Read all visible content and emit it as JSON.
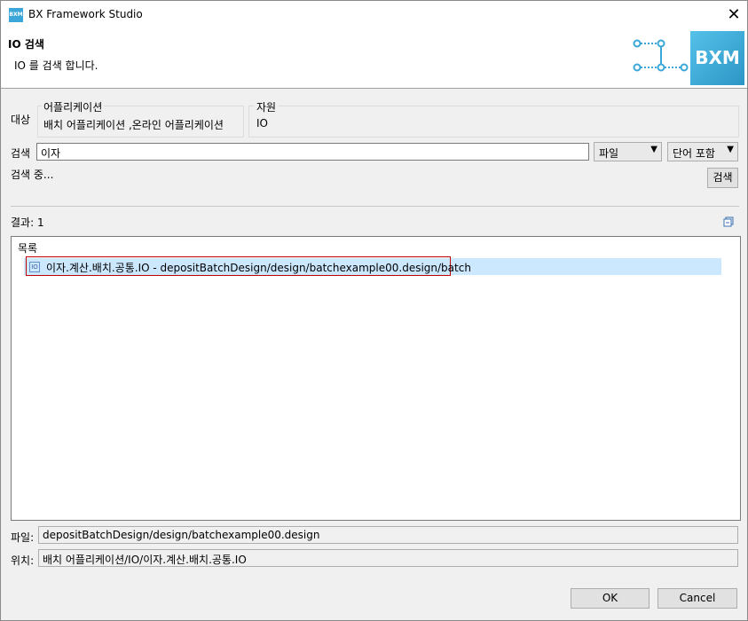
{
  "window": {
    "title": "BX Framework Studio",
    "app_icon_label": "BXM",
    "close_glyph": "✕"
  },
  "header": {
    "title": "IO 검색",
    "description": "IO 를 검색 합니다.",
    "logo_text": "BXM"
  },
  "target": {
    "label": "대상",
    "application_group": {
      "title": "어플리케이션",
      "value": "배치 어플리케이션 ,온라인 어플리케이션"
    },
    "resource_group": {
      "title": "자원",
      "value": "IO"
    }
  },
  "search": {
    "label": "검색",
    "query": "이자",
    "scope_select": "파일",
    "match_select": "단어 포함",
    "status": "검색 중...",
    "button": "검색"
  },
  "results": {
    "label": "결과: 1",
    "list_header": "목록",
    "items": [
      {
        "icon": "IO",
        "text": "이자.계산.배치.공통.IO - depositBatchDesign/design/batchexample00.design/batch"
      }
    ]
  },
  "details": {
    "file_label": "파일:",
    "file_value": "depositBatchDesign/design/batchexample00.design",
    "location_label": "위치:",
    "location_value": "배치 어플리케이션/IO/이자.계산.배치.공통.IO"
  },
  "footer": {
    "ok": "OK",
    "cancel": "Cancel"
  },
  "colors": {
    "selection": "#cce8ff",
    "highlight_border": "#c00000",
    "brand": "#3aa7d8"
  }
}
